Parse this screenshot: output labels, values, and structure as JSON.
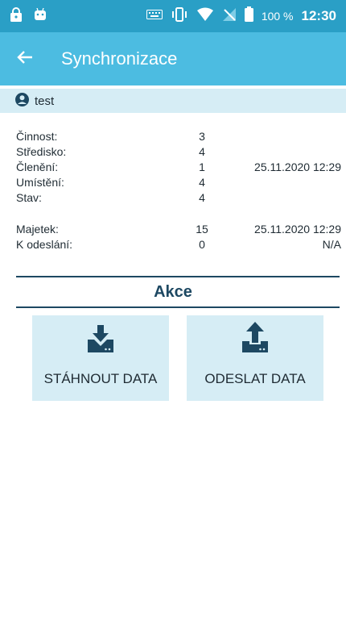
{
  "status_bar": {
    "battery_percent": "100 %",
    "time": "12:30",
    "icons": [
      "lock-icon",
      "android-icon",
      "keyboard-icon",
      "vibrate-icon",
      "wifi-icon",
      "no-sim-icon",
      "battery-icon"
    ]
  },
  "app_bar": {
    "title": "Synchronizace",
    "back_icon": "arrow-left-icon"
  },
  "user": {
    "icon": "user-circle-icon",
    "name": "test"
  },
  "stats": [
    {
      "label": "Činnost:",
      "count": "3",
      "date": ""
    },
    {
      "label": "Středisko:",
      "count": "4",
      "date": ""
    },
    {
      "label": "Členění:",
      "count": "1",
      "date": "25.11.2020 12:29"
    },
    {
      "label": "Umístění:",
      "count": "4",
      "date": ""
    },
    {
      "label": "Stav:",
      "count": "4",
      "date": ""
    }
  ],
  "stats2": [
    {
      "label": "Majetek:",
      "count": "15",
      "date": "25.11.2020 12:29"
    },
    {
      "label": "K odeslání:",
      "count": "0",
      "date": "N/A"
    }
  ],
  "actions": {
    "title": "Akce",
    "download": {
      "label": "STÁHNOUT DATA",
      "icon": "download-icon"
    },
    "upload": {
      "label": "ODESLAT DATA",
      "icon": "upload-icon"
    }
  },
  "colors": {
    "status_bar": "#2a9fc6",
    "app_bar": "#4cbce1",
    "light_panel": "#d6edf5",
    "accent_dark": "#1d4862"
  }
}
